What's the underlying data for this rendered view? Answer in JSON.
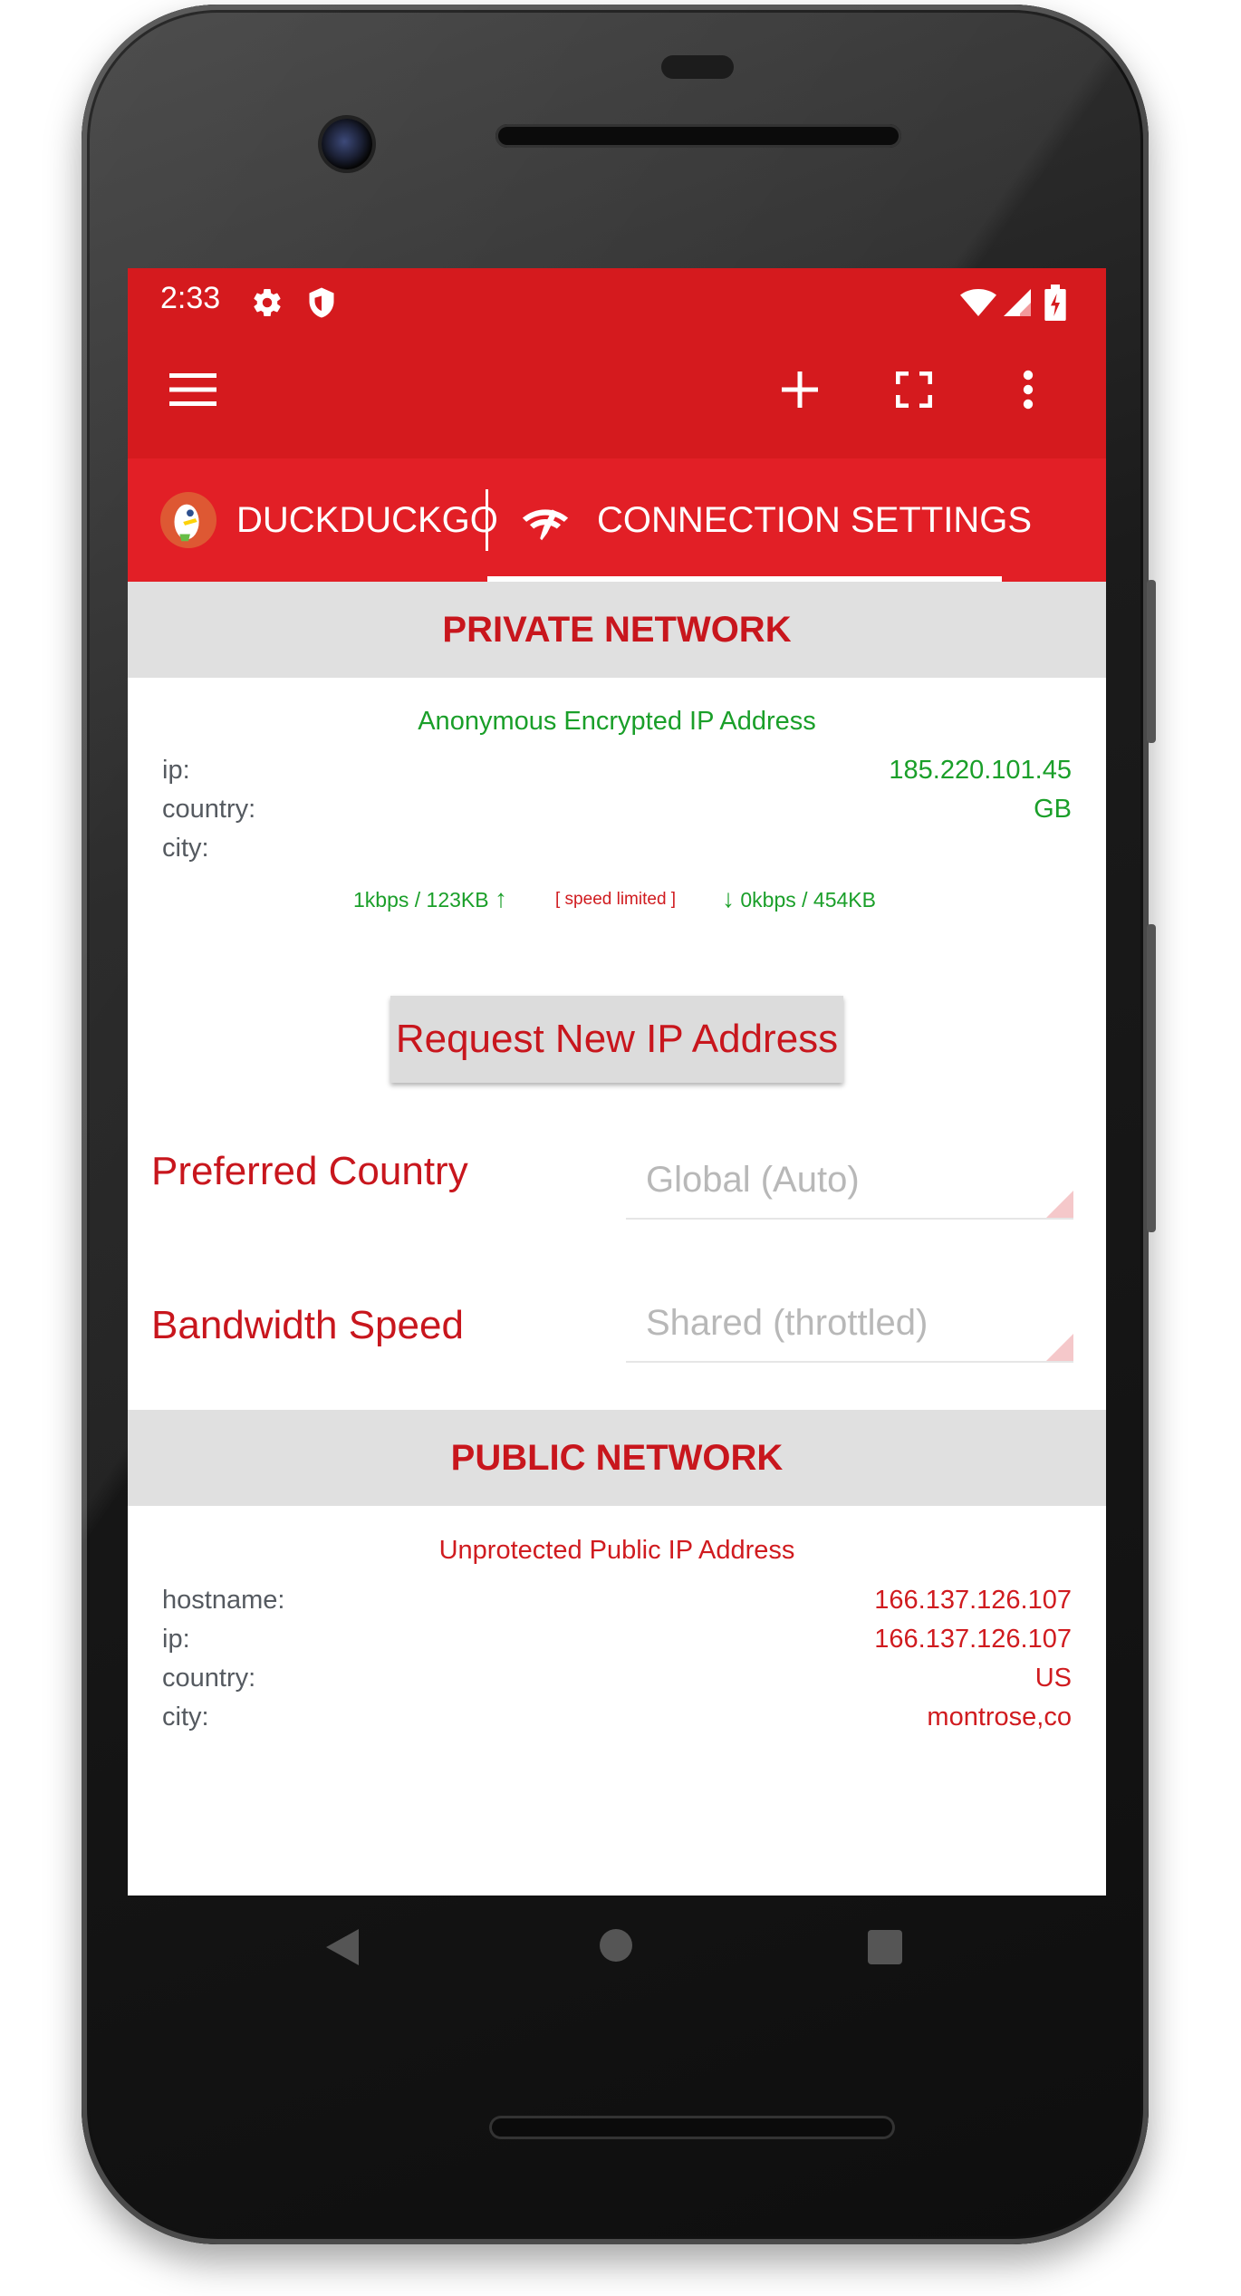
{
  "status_bar": {
    "time": "2:33",
    "icons": [
      "gear-icon",
      "shield-icon",
      "wifi-icon",
      "signal-icon",
      "battery-icon"
    ]
  },
  "toolbar": {
    "menu_icon": "hamburger-menu-icon",
    "actions": [
      "plus-icon",
      "fullscreen-icon",
      "more-vert-icon"
    ]
  },
  "tabs": [
    {
      "label": "DUCKDUCKGO",
      "icon": "duckduckgo-logo-icon",
      "selected": false
    },
    {
      "label": "CONNECTION SETTINGS",
      "icon": "wifi-settings-icon",
      "selected": true
    }
  ],
  "private_network": {
    "header": "PRIVATE NETWORK",
    "subtitle": "Anonymous Encrypted IP Address",
    "rows": [
      {
        "label": "ip:",
        "value": "185.220.101.45"
      },
      {
        "label": "country:",
        "value": "GB"
      },
      {
        "label": "city:",
        "value": ""
      }
    ],
    "upload": "1kbps / 123KB",
    "speed_note": "[ speed limited ]",
    "download": "0kbps / 454KB",
    "request_button": "Request New IP Address"
  },
  "preferences": {
    "country_label": "Preferred Country",
    "country_value": "Global (Auto)",
    "bandwidth_label": "Bandwidth Speed",
    "bandwidth_value": "Shared (throttled)"
  },
  "public_network": {
    "header": "PUBLIC NETWORK",
    "subtitle": "Unprotected Public IP Address",
    "rows": [
      {
        "label": "hostname:",
        "value": "166.137.126.107"
      },
      {
        "label": "ip:",
        "value": "166.137.126.107"
      },
      {
        "label": "country:",
        "value": "US"
      },
      {
        "label": "city:",
        "value": "montrose,co"
      }
    ]
  },
  "colors": {
    "appbar": "#d51a1e",
    "tabs": "#e21f26",
    "accent_red": "#c8161d",
    "ok_green": "#1a9f29"
  }
}
